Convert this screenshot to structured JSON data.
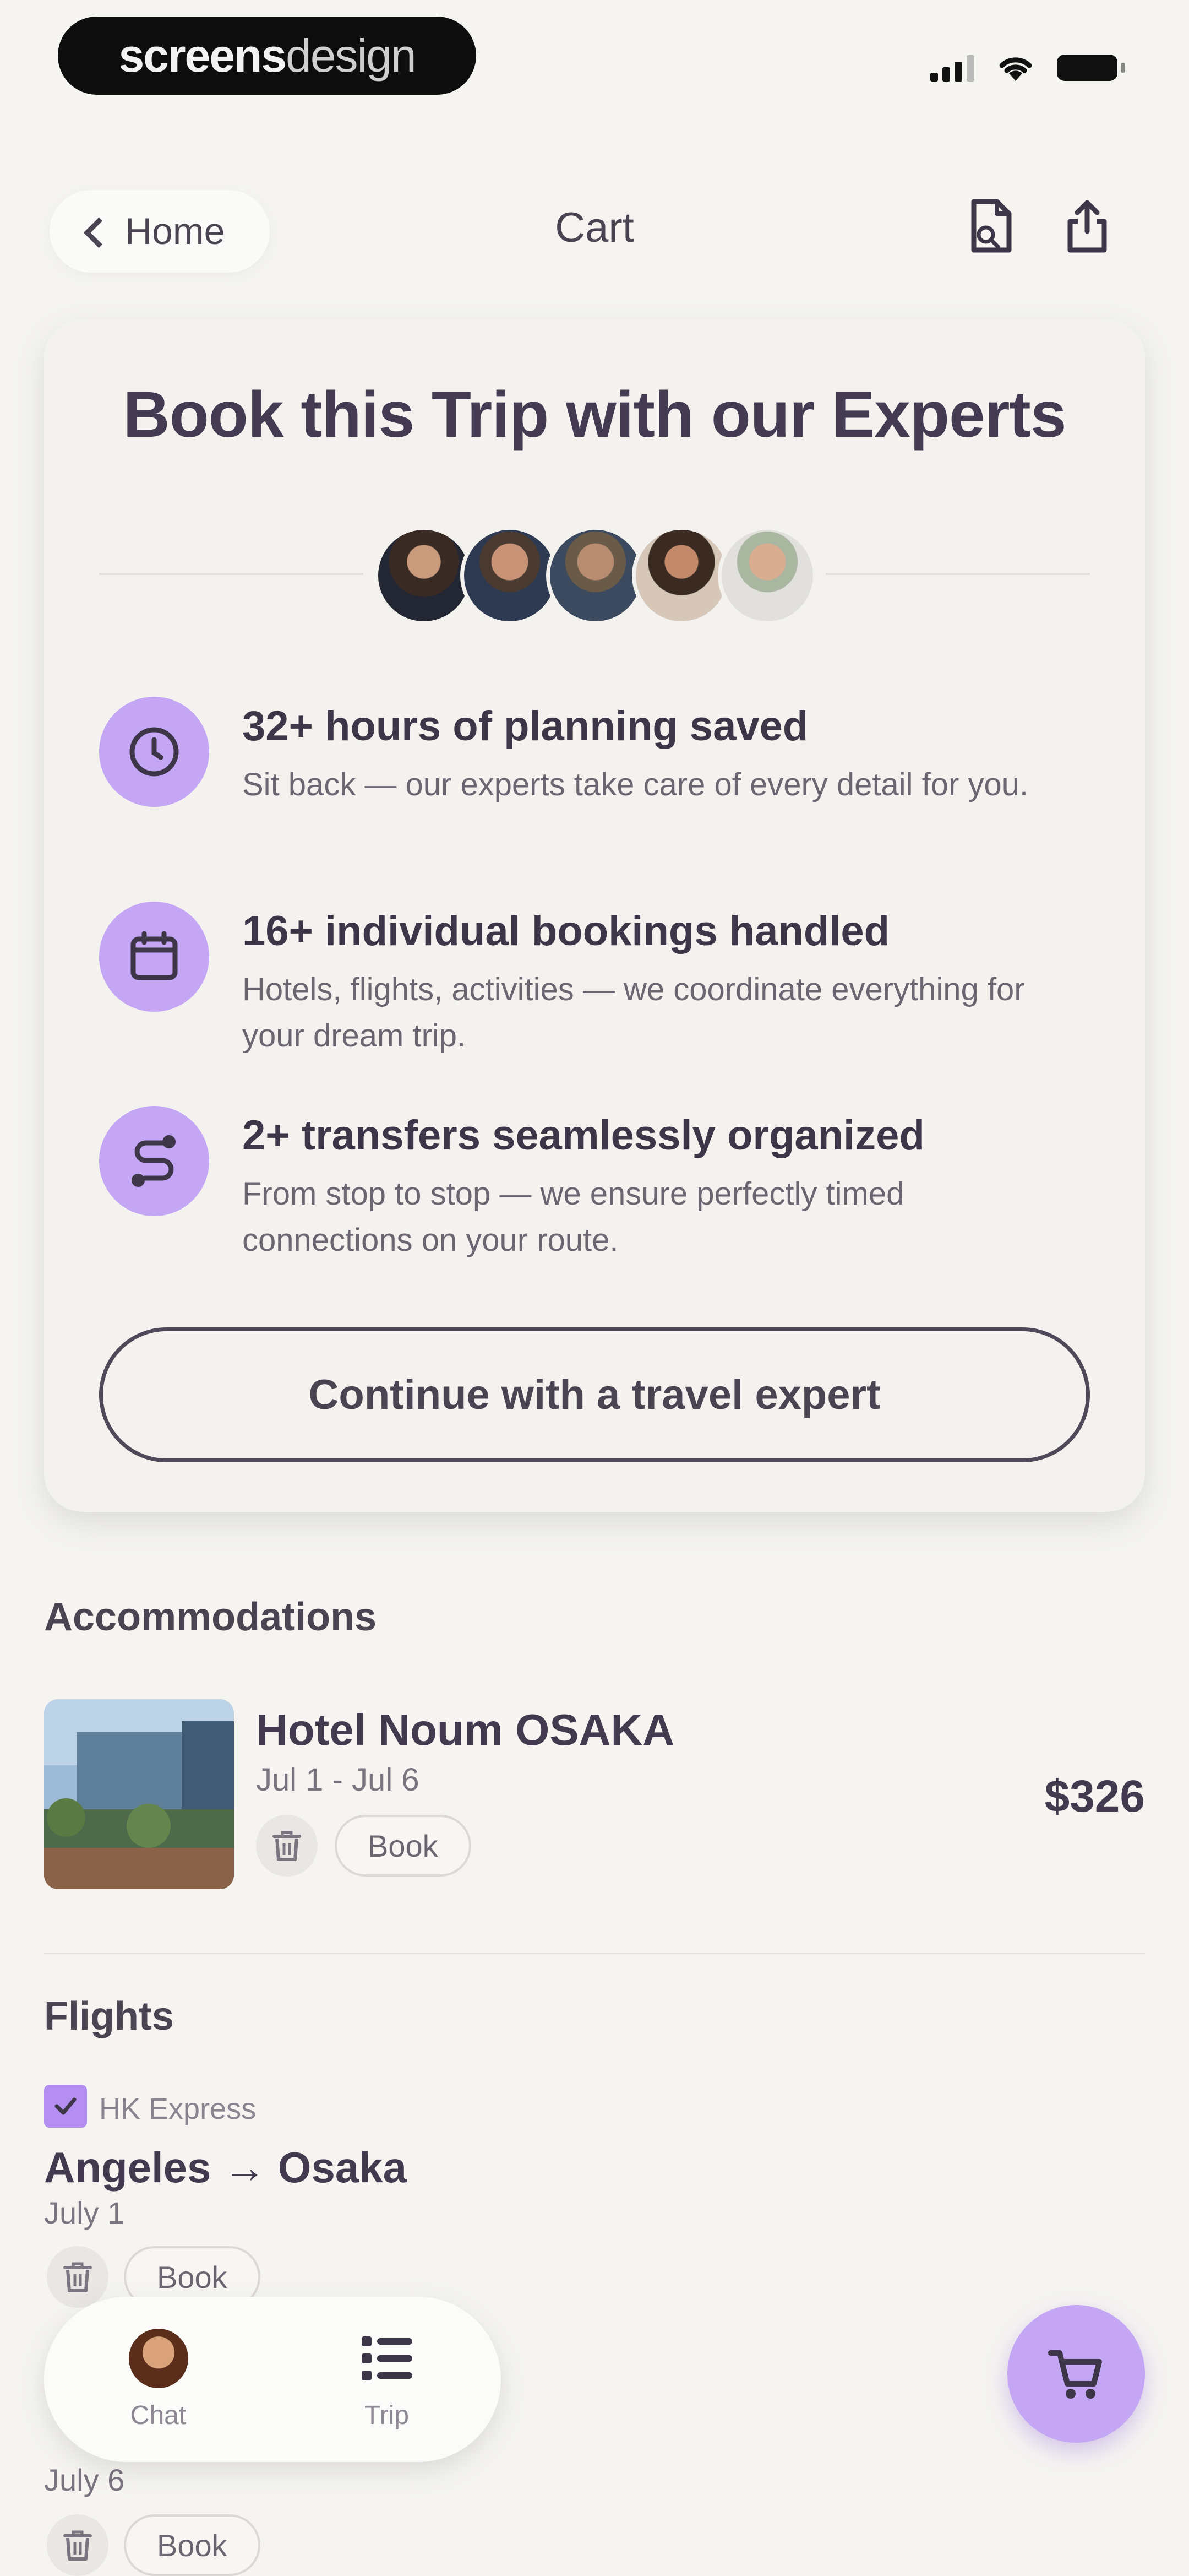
{
  "status_bar": {
    "brand_bold": "screens",
    "brand_light": "design"
  },
  "header": {
    "back_label": "Home",
    "title": "Cart",
    "icons": [
      "document-icon",
      "share-icon"
    ]
  },
  "expert_card": {
    "title": "Book this Trip with our Experts",
    "avatar_count": 5,
    "features": [
      {
        "icon": "clock-icon",
        "title": "32+ hours of planning saved",
        "desc": "Sit back — our experts take care of every detail for you."
      },
      {
        "icon": "calendar-icon",
        "title": "16+ individual bookings handled",
        "desc": "Hotels, flights, activities — we coordinate everything for your dream trip."
      },
      {
        "icon": "route-icon",
        "title": "2+ transfers seamlessly organized",
        "desc": "From stop to stop — we ensure perfectly timed connections on your route."
      }
    ],
    "cta_label": "Continue with a travel expert"
  },
  "accommodations": {
    "heading": "Accommodations",
    "items": [
      {
        "name": "Hotel Noum OSAKA",
        "dates": "Jul 1 - Jul 6",
        "price": "$326",
        "book_label": "Book"
      }
    ]
  },
  "flights": {
    "heading": "Flights",
    "items": [
      {
        "airline": "HK Express",
        "route": "Angeles → Osaka",
        "date": "July 1",
        "book_label": "Book"
      },
      {
        "date": "July 6",
        "book_label": "Book"
      }
    ]
  },
  "tabbar": {
    "tabs": [
      {
        "label": "Chat",
        "icon": "avatar"
      },
      {
        "label": "Trip",
        "icon": "list-icon"
      }
    ]
  },
  "fab": {
    "icon": "cart-icon"
  },
  "colors": {
    "accent": "#c4a6f5",
    "background": "#f5f4f1",
    "text": "#3d3548"
  }
}
